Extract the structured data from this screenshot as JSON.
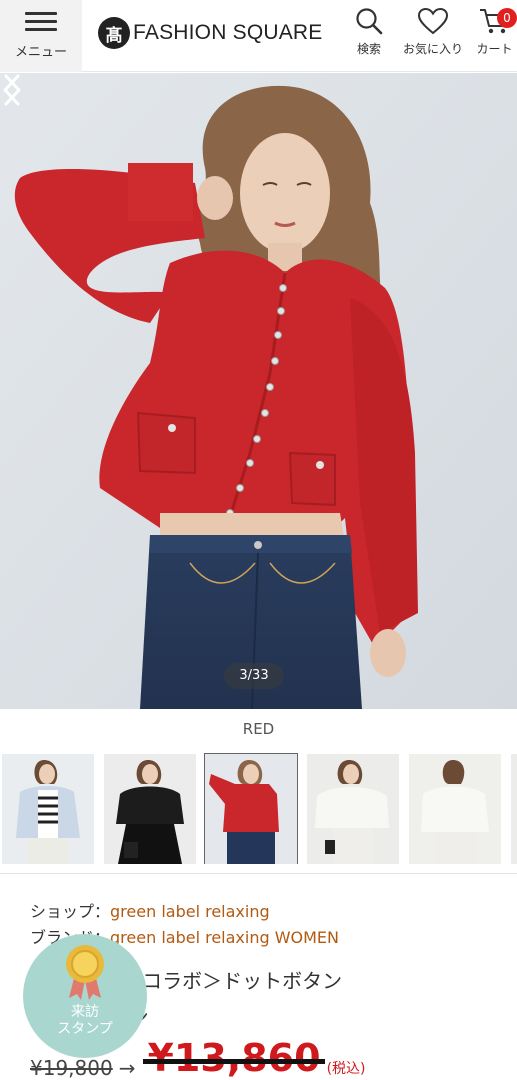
{
  "header": {
    "menu_label": "メニュー",
    "logo_mark": "髙",
    "logo_text": "FASHION SQUARE",
    "search_label": "検索",
    "favorites_label": "お気に入り",
    "cart_label": "カート",
    "cart_count": "0"
  },
  "gallery": {
    "counter": "3/33",
    "color_name": "RED",
    "thumbnails": [
      {
        "color": "light-blue"
      },
      {
        "color": "black"
      },
      {
        "color": "red",
        "selected": true
      },
      {
        "color": "white"
      },
      {
        "color": "white-back"
      }
    ]
  },
  "product": {
    "shop_label": "ショップ：",
    "shop_name": "green label relaxing",
    "brand_label": "ブランド：",
    "brand_name": "green label relaxing WOMEN",
    "title_line1": "＜ agnes b.コラボ＞ドットボタン",
    "title_line2": "カーディガン",
    "old_price": "¥19,800",
    "arrow": "→",
    "new_price": "¥13,860",
    "tax_note": "(税込)"
  },
  "stamp": {
    "line1": "来訪",
    "line2": "スタンプ"
  },
  "colors": {
    "accent_link": "#b25a11",
    "price_red": "#d0191c",
    "cart_badge": "#e02020",
    "stamp_bg": "#a9d7d0"
  }
}
